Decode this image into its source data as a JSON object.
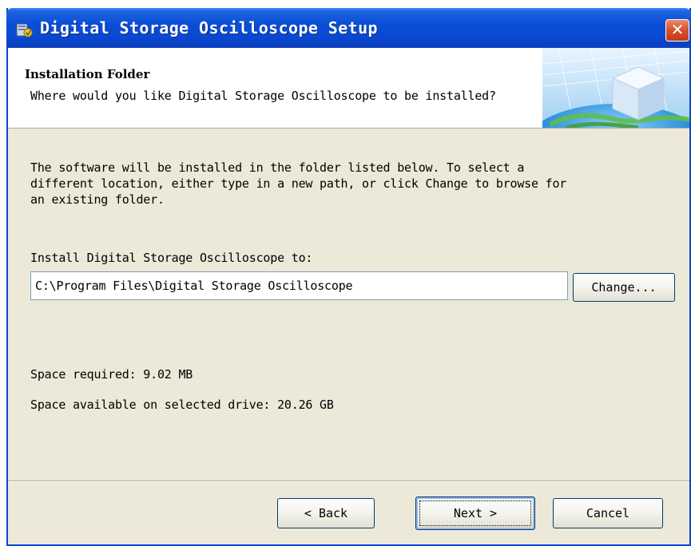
{
  "window": {
    "title": "Digital Storage Oscilloscope Setup",
    "close_glyph": "✕",
    "app_icon": "setup-icon"
  },
  "header": {
    "title": "Installation Folder",
    "subtitle": "Where would you like Digital Storage Oscilloscope to be installed?",
    "graphic": "globe-cube-graphic"
  },
  "body": {
    "description": "The software will be installed in the folder listed below. To select a\ndifferent location, either type in a new path, or click Change to browse for\nan existing folder.",
    "install_label": "Install Digital Storage Oscilloscope to:",
    "install_path": "C:\\Program Files\\Digital Storage Oscilloscope",
    "change_button": "Change...",
    "space_required": "Space required: 9.02 MB",
    "space_available": "Space available on selected drive: 20.26 GB"
  },
  "footer": {
    "back_button": "< Back",
    "next_button": "Next >",
    "cancel_button": "Cancel"
  },
  "colors": {
    "titlebar": "#0a4ed6",
    "dialog_bg": "#ece9d8",
    "close_button": "#d8502c"
  }
}
